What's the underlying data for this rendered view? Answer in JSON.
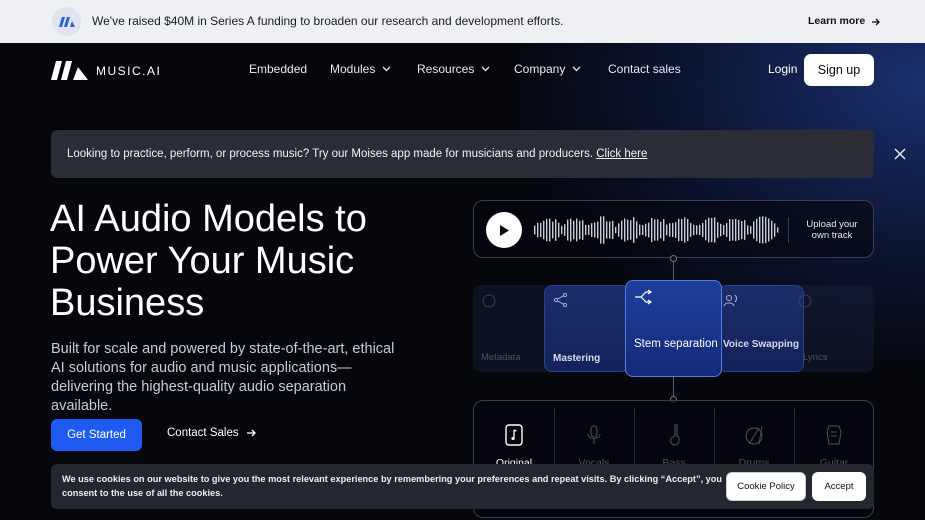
{
  "announcement": {
    "message": "We've raised $40M in Series A funding to broaden our research and development efforts.",
    "cta": "Learn more"
  },
  "nav": {
    "brand": "MUSIC.AI",
    "items": [
      {
        "label": "Embedded",
        "dropdown": false
      },
      {
        "label": "Modules",
        "dropdown": true
      },
      {
        "label": "Resources",
        "dropdown": true
      },
      {
        "label": "Company",
        "dropdown": true
      },
      {
        "label": "Contact sales",
        "dropdown": false
      }
    ],
    "login": "Login",
    "signup": "Sign up"
  },
  "notice": {
    "text": "Looking to practice, perform, or process music? Try our Moises app made for musicians and producers.",
    "link": "Click here"
  },
  "hero": {
    "title": "AI Audio Models to Power Your Music Business",
    "subtitle": "Built for scale and powered by state-of-the-art, ethical AI solutions for audio and music applications—delivering the highest-quality audio separation available.",
    "primary_cta": "Get Started",
    "secondary_cta": "Contact Sales"
  },
  "visual": {
    "upload_label": "Upload your own track",
    "modules": [
      "Metadata",
      "Mastering",
      "Stem separation",
      "Voice Swapping",
      "Lyrics"
    ],
    "active_module": "Stem separation",
    "stems": [
      "Original",
      "Vocals",
      "Bass",
      "Drums",
      "Guitar"
    ]
  },
  "cookie": {
    "text": "We use cookies on our website to give you the most relevant experience by remembering your preferences and repeat visits. By clicking “Accept”, you consent to the use of all the cookies.",
    "policy": "Cookie Policy",
    "accept": "Accept"
  },
  "colors": {
    "accent": "#1f5bf2",
    "background": "#05070d",
    "announcement_bg": "#eef0f4"
  }
}
